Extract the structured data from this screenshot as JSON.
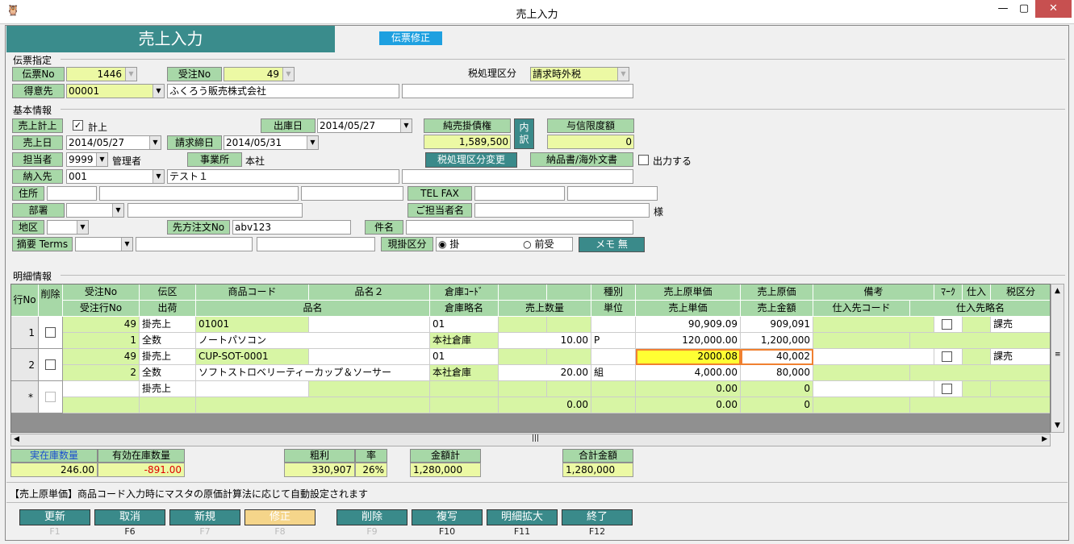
{
  "window": {
    "title": "売上入力"
  },
  "banner": {
    "title": "売上入力",
    "mode": "伝票修正"
  },
  "slip": {
    "section": "伝票指定",
    "slip_no_label": "伝票No",
    "slip_no": "1446",
    "order_no_label": "受注No",
    "order_no": "49",
    "tax_label": "税処理区分",
    "tax_value": "請求時外税",
    "customer_label": "得意先",
    "customer_code": "00001",
    "customer_name": "ふくろう販売株式会社"
  },
  "basic": {
    "section": "基本情報",
    "sales_post_label": "売上計上",
    "sales_post_check": "✓",
    "sales_post_text": "計上",
    "ship_date_label": "出庫日",
    "ship_date": "2014/05/27",
    "net_receivable_label": "純売掛債権",
    "net_receivable": "1,589,500",
    "breakdown_btn": "内訳",
    "credit_limit_label": "与信限度額",
    "credit_limit": "0",
    "sales_date_label": "売上日",
    "sales_date": "2014/05/27",
    "closing_date_label": "請求締日",
    "closing_date": "2014/05/31",
    "staff_label": "担当者",
    "staff_code": "9999",
    "staff_name": "管理者",
    "office_label": "事業所",
    "office_name": "本社",
    "tax_change_btn": "税処理区分変更",
    "delivery_doc_label": "納品書/海外文書",
    "output_text": "出力する",
    "dest_label": "納入先",
    "dest_code": "001",
    "dest_name": "テスト１",
    "address_label": "住所",
    "telfax_label": "TEL FAX",
    "dept_label": "部署",
    "contact_label": "ご担当者名",
    "honorific": "様",
    "area_label": "地区",
    "po_label": "先方注文No",
    "po_value": "abv123",
    "subject_label": "件名",
    "memo_label": "摘要 Terms",
    "payment_label": "現掛区分",
    "payment_credit": "掛",
    "payment_advance": "前受",
    "memo_btn": "メモ 無"
  },
  "detail": {
    "section": "明細情報",
    "headers_top": [
      "受注No",
      "伝区",
      "商品コード",
      "品名２",
      "倉庫ｺｰﾄﾞ",
      "",
      "",
      "種別",
      "売上原単価",
      "売上原価",
      "備考",
      "ﾏｰｸ",
      "仕入",
      "税区分"
    ],
    "headers_bottom": [
      "受注行No",
      "出荷",
      "品名",
      "倉庫略名",
      "売上数量",
      "単位",
      "売上単価",
      "売上金額",
      "仕入先コード",
      "仕入先略名"
    ],
    "row_no_header": "行No",
    "delete_header": "削除",
    "rows": [
      {
        "no": "1",
        "order_no": "49",
        "slip_type": "掛売上",
        "item_code": "01001",
        "item_name2": "",
        "wh_code": "01",
        "cost_unit": "90,909.09",
        "cost": "909,091",
        "tax": "課売",
        "order_line": "1",
        "ship": "全数",
        "item_name": "ノートパソコン",
        "wh_name": "本社倉庫",
        "qty": "10.00",
        "unit": "P",
        "price": "120,000.00",
        "amount": "1,200,000"
      },
      {
        "no": "2",
        "order_no": "49",
        "slip_type": "掛売上",
        "item_code": "CUP-SOT-0001",
        "item_name2": "",
        "wh_code": "01",
        "cost_unit": "2000.08",
        "cost": "40,002",
        "tax": "課売",
        "order_line": "2",
        "ship": "全数",
        "item_name": "ソフトストロベリーティーカップ＆ソーサー",
        "wh_name": "本社倉庫",
        "qty": "20.00",
        "unit": "組",
        "price": "4,000.00",
        "amount": "80,000"
      },
      {
        "no": "*",
        "order_no": "",
        "slip_type": "掛売上",
        "item_code": "",
        "item_name2": "",
        "wh_code": "",
        "cost_unit": "0.00",
        "cost": "0",
        "tax": "",
        "order_line": "",
        "ship": "",
        "item_name": "",
        "wh_name": "",
        "qty": "0.00",
        "unit": "",
        "price": "0.00",
        "amount": "0"
      }
    ]
  },
  "summary": {
    "stock_label": "実在庫数量",
    "stock": "246.00",
    "avail_label": "有効在庫数量",
    "avail": "-891.00",
    "gross_label": "粗利",
    "gross": "330,907",
    "rate_label": "率",
    "rate": "26%",
    "subtotal_label": "金額計",
    "subtotal": "1,280,000",
    "total_label": "合計金額",
    "total": "1,280,000"
  },
  "hint": "【売上原単価】商品コード入力時にマスタの原価計算法に応じて自動設定されます",
  "fkeys": [
    {
      "label": "更新",
      "key": "F1"
    },
    {
      "label": "取消",
      "key": "F6"
    },
    {
      "label": "新規",
      "key": "F7"
    },
    {
      "label": "修正",
      "key": "F8"
    },
    {
      "label": "削除",
      "key": "F9"
    },
    {
      "label": "複写",
      "key": "F10"
    },
    {
      "label": "明細拡大",
      "key": "F11"
    },
    {
      "label": "終了",
      "key": "F12"
    }
  ]
}
